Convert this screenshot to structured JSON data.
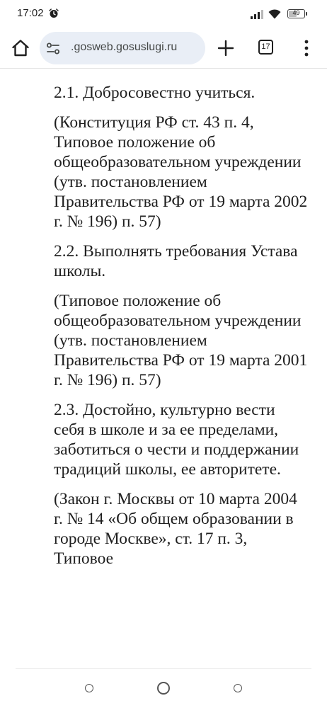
{
  "status_bar": {
    "time": "17:02",
    "battery_level": "49"
  },
  "toolbar": {
    "url": ".gosweb.gosuslugi.ru",
    "tab_count": "17"
  },
  "content": {
    "paragraphs": [
      "2.1. Добросовестно учиться.",
      "(Конституция РФ ст. 43 п. 4, Типовое положение об общеобразовательном учреждении (утв. постановлением Правительства РФ от 19 марта 2002 г. № 196) п. 57)",
      "2.2. Выполнять требования Устава школы.",
      "(Типовое положение об общеобразовательном учреждении (утв. постановлением Правительства РФ от 19 марта 2001 г. № 196) п. 57)",
      "2.3. Достойно, культурно вести себя в школе и за ее пределами, заботиться о чести и поддержании традиций школы, ее авторитете.",
      "(Закон г. Москвы от 10 марта 2004 г. № 14 «Об общем образовании в городе Москве», ст. 17 п. 3, Типовое"
    ]
  },
  "icons": {
    "alarm": "alarm-icon",
    "signal": "signal-icon",
    "wifi": "wifi-icon",
    "battery": "battery-icon",
    "home": "home-icon",
    "site_settings": "site-settings-icon",
    "new_tab": "plus-icon",
    "menu": "more-vertical-icon"
  }
}
